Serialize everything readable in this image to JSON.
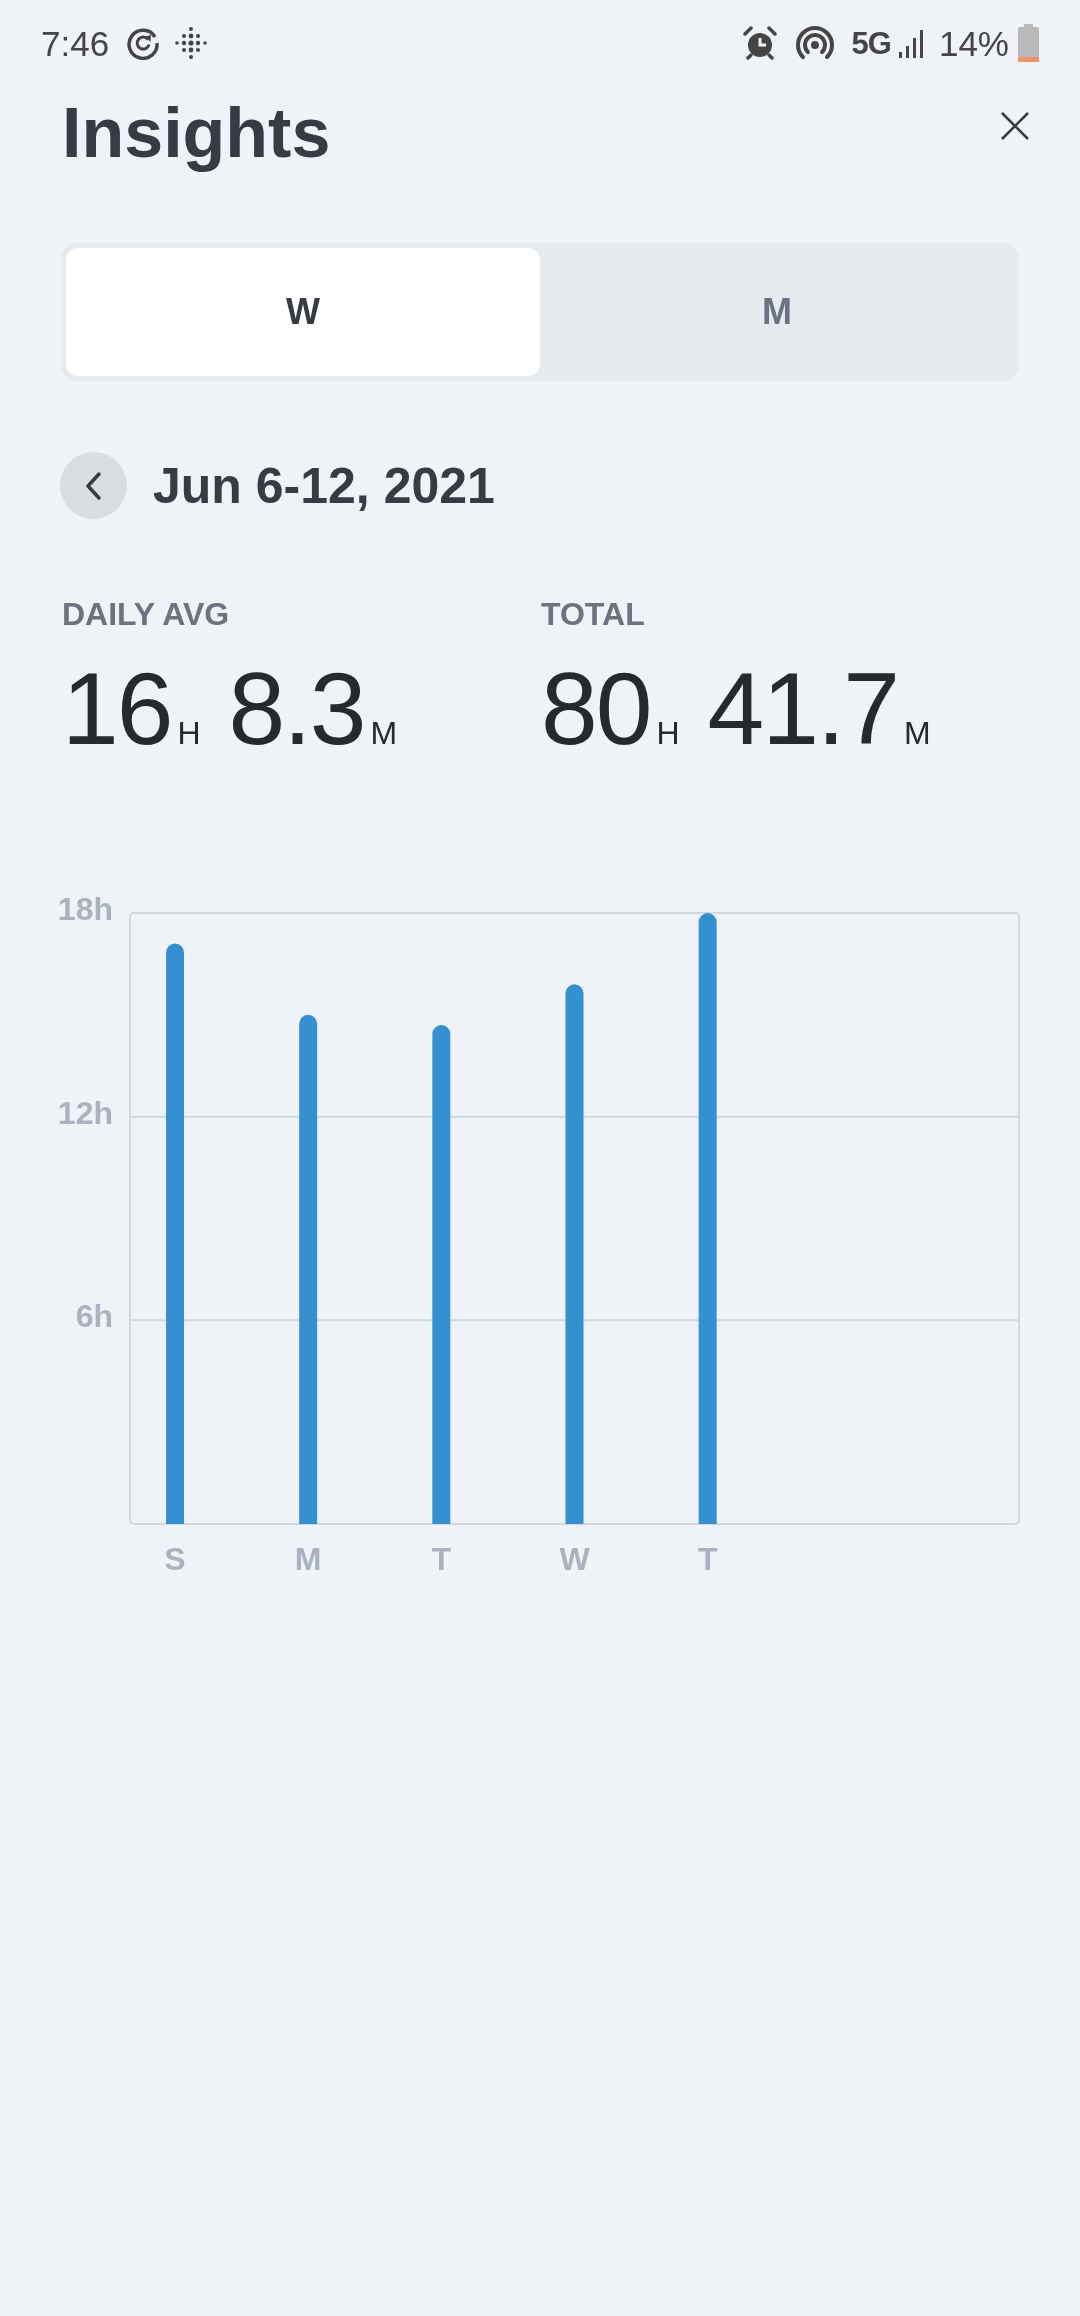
{
  "status_bar": {
    "time": "7:46",
    "network": "5G",
    "battery": "14%"
  },
  "header": {
    "title": "Insights"
  },
  "tabs": [
    {
      "label": "W",
      "selected": true
    },
    {
      "label": "M",
      "selected": false
    }
  ],
  "period": {
    "label": "Jun 6-12, 2021"
  },
  "stats": [
    {
      "label": "DAILY AVG",
      "hours": "16",
      "hours_unit": "H",
      "minutes": "8.3",
      "minutes_unit": "M"
    },
    {
      "label": "TOTAL",
      "hours": "80",
      "hours_unit": "H",
      "minutes": "41.7",
      "minutes_unit": "M"
    }
  ],
  "chart": {
    "chart_data": {
      "type": "bar",
      "categories": [
        "S",
        "M",
        "T",
        "W",
        "T"
      ],
      "values": [
        17.1,
        15.0,
        14.7,
        15.9,
        18.0
      ],
      "ylim": [
        0,
        18
      ],
      "yticks": [
        {
          "value": 6,
          "label": "6h"
        },
        {
          "value": 12,
          "label": "12h"
        },
        {
          "value": 18,
          "label": "18h"
        }
      ]
    }
  }
}
